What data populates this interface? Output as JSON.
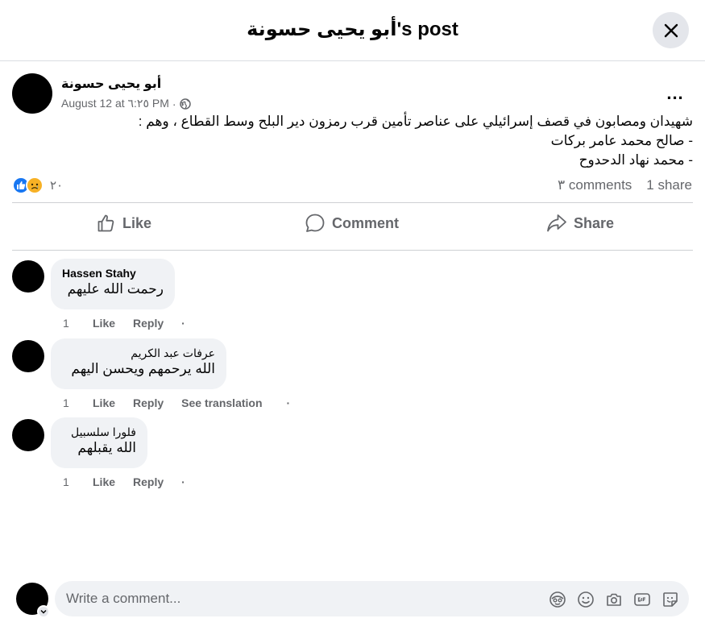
{
  "header": {
    "title": "أبو يحيى حسونة's post"
  },
  "post": {
    "author": "أبو يحيى حسونة",
    "date": "August 12 at ٦:٢٥ PM",
    "separator": "·",
    "lines": [
      "شهيدان ومصابون في قصف إسرائيلي على عناصر تأمين قرب رمزون دير البلح وسط القطاع ، وهم :",
      "- صالح محمد عامر بركات",
      "- محمد نهاد الدحدوح"
    ],
    "reaction_count": "٢٠",
    "comments_count": "٣ comments",
    "shares_count": "1 share",
    "menu": "..."
  },
  "actions": {
    "like": "Like",
    "comment": "Comment",
    "share": "Share"
  },
  "comments": [
    {
      "name": "Hassen Stahy",
      "text": "رحمت الله عليهم",
      "time": "1",
      "like": "Like",
      "reply": "Reply",
      "dot": "·"
    },
    {
      "name": "عرفات عبد الكريم",
      "text": "الله يرحمهم ويحسن اليهم",
      "time": "1",
      "like": "Like",
      "reply": "Reply",
      "translate": "See translation",
      "dot": "·"
    },
    {
      "name": "فلورا سلسبيل",
      "text": "الله يقبلهم",
      "time": "1",
      "like": "Like",
      "reply": "Reply",
      "dot": "·"
    }
  ],
  "composer": {
    "placeholder": "Write a comment..."
  },
  "colors": {
    "like_blue": "#1877f2",
    "sad_yellow": "#f7b125",
    "secondary_text": "#65676b",
    "bubble_bg": "#f0f2f5"
  }
}
